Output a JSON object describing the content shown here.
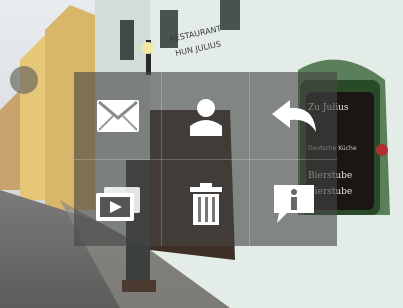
{
  "photo": {
    "sign_text_1": "RESTAURANT",
    "sign_text_2": "HUN JULIUS",
    "board_title": "Zu Julius",
    "board_line_1": "Bierstube",
    "board_line_2": "Bierstube",
    "board_small": "Deutsche Küche"
  },
  "menu": {
    "items": [
      {
        "icon": "mail-icon",
        "label": ""
      },
      {
        "icon": "contact-icon",
        "label": ""
      },
      {
        "icon": "back-icon",
        "label": ""
      },
      {
        "icon": "slideshow-icon",
        "label": ""
      },
      {
        "icon": "trash-icon",
        "label": ""
      },
      {
        "icon": "info-icon",
        "label": ""
      }
    ]
  },
  "colors": {
    "overlay": "#464646",
    "icon": "#ffffff"
  }
}
